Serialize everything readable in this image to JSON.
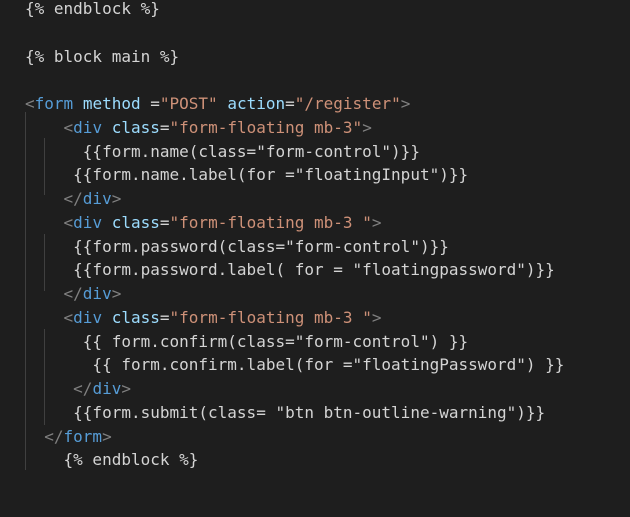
{
  "editor": {
    "lines": [
      [
        {
          "t": "{% endblock %}",
          "c": "txt"
        }
      ],
      [],
      [
        {
          "t": "{% block main %}",
          "c": "txt"
        }
      ],
      [],
      [
        {
          "t": "<",
          "c": "punct"
        },
        {
          "t": "form",
          "c": "tag"
        },
        {
          "t": " ",
          "c": "txt"
        },
        {
          "t": "method",
          "c": "attr"
        },
        {
          "t": " =",
          "c": "txt"
        },
        {
          "t": "\"POST\"",
          "c": "str"
        },
        {
          "t": " ",
          "c": "txt"
        },
        {
          "t": "action",
          "c": "attr"
        },
        {
          "t": "=",
          "c": "txt"
        },
        {
          "t": "\"/register\"",
          "c": "str"
        },
        {
          "t": ">",
          "c": "punct"
        }
      ],
      [
        {
          "t": "    ",
          "c": "txt"
        },
        {
          "t": "<",
          "c": "punct"
        },
        {
          "t": "div",
          "c": "tag"
        },
        {
          "t": " ",
          "c": "txt"
        },
        {
          "t": "class",
          "c": "attr"
        },
        {
          "t": "=",
          "c": "txt"
        },
        {
          "t": "\"form-floating mb-3\"",
          "c": "str"
        },
        {
          "t": ">",
          "c": "punct"
        }
      ],
      [
        {
          "t": "      {{form.name(class=\"form-control\")}}",
          "c": "txt"
        }
      ],
      [
        {
          "t": "     {{form.name.label(for =\"floatingInput\")}}",
          "c": "txt"
        }
      ],
      [
        {
          "t": "    ",
          "c": "txt"
        },
        {
          "t": "</",
          "c": "punct"
        },
        {
          "t": "div",
          "c": "tag"
        },
        {
          "t": ">",
          "c": "punct"
        }
      ],
      [
        {
          "t": "    ",
          "c": "txt"
        },
        {
          "t": "<",
          "c": "punct"
        },
        {
          "t": "div",
          "c": "tag"
        },
        {
          "t": " ",
          "c": "txt"
        },
        {
          "t": "class",
          "c": "attr"
        },
        {
          "t": "=",
          "c": "txt"
        },
        {
          "t": "\"form-floating mb-3 \"",
          "c": "str"
        },
        {
          "t": ">",
          "c": "punct"
        }
      ],
      [
        {
          "t": "     {{form.password(class=\"form-control\")}}",
          "c": "txt"
        }
      ],
      [
        {
          "t": "     {{form.password.label( for = \"floatingpassword\")}}",
          "c": "txt"
        }
      ],
      [
        {
          "t": "    ",
          "c": "txt"
        },
        {
          "t": "</",
          "c": "punct"
        },
        {
          "t": "div",
          "c": "tag"
        },
        {
          "t": ">",
          "c": "punct"
        }
      ],
      [
        {
          "t": "    ",
          "c": "txt"
        },
        {
          "t": "<",
          "c": "punct"
        },
        {
          "t": "div",
          "c": "tag"
        },
        {
          "t": " ",
          "c": "txt"
        },
        {
          "t": "class",
          "c": "attr"
        },
        {
          "t": "=",
          "c": "txt"
        },
        {
          "t": "\"form-floating mb-3 \"",
          "c": "str"
        },
        {
          "t": ">",
          "c": "punct"
        }
      ],
      [
        {
          "t": "      {{ form.confirm(class=\"form-control\") }}",
          "c": "txt"
        }
      ],
      [
        {
          "t": "       {{ form.confirm.label(for =\"floatingPassword\") }}",
          "c": "txt"
        }
      ],
      [
        {
          "t": "     ",
          "c": "txt"
        },
        {
          "t": "</",
          "c": "punct"
        },
        {
          "t": "div",
          "c": "tag"
        },
        {
          "t": ">",
          "c": "punct"
        }
      ],
      [
        {
          "t": "     {{form.submit(class= \"btn btn-outline-warning\")}}",
          "c": "txt"
        }
      ],
      [
        {
          "t": "  ",
          "c": "txt"
        },
        {
          "t": "</",
          "c": "punct"
        },
        {
          "t": "form",
          "c": "tag"
        },
        {
          "t": ">",
          "c": "punct"
        }
      ],
      [
        {
          "t": "    {% endblock %}",
          "c": "txt"
        }
      ]
    ]
  },
  "colors": {
    "background": "#1e1e1e",
    "tag": "#569cd6",
    "attribute": "#9cdcfe",
    "string": "#ce9178",
    "punctuation": "#808080",
    "text": "#d4d4d4"
  }
}
